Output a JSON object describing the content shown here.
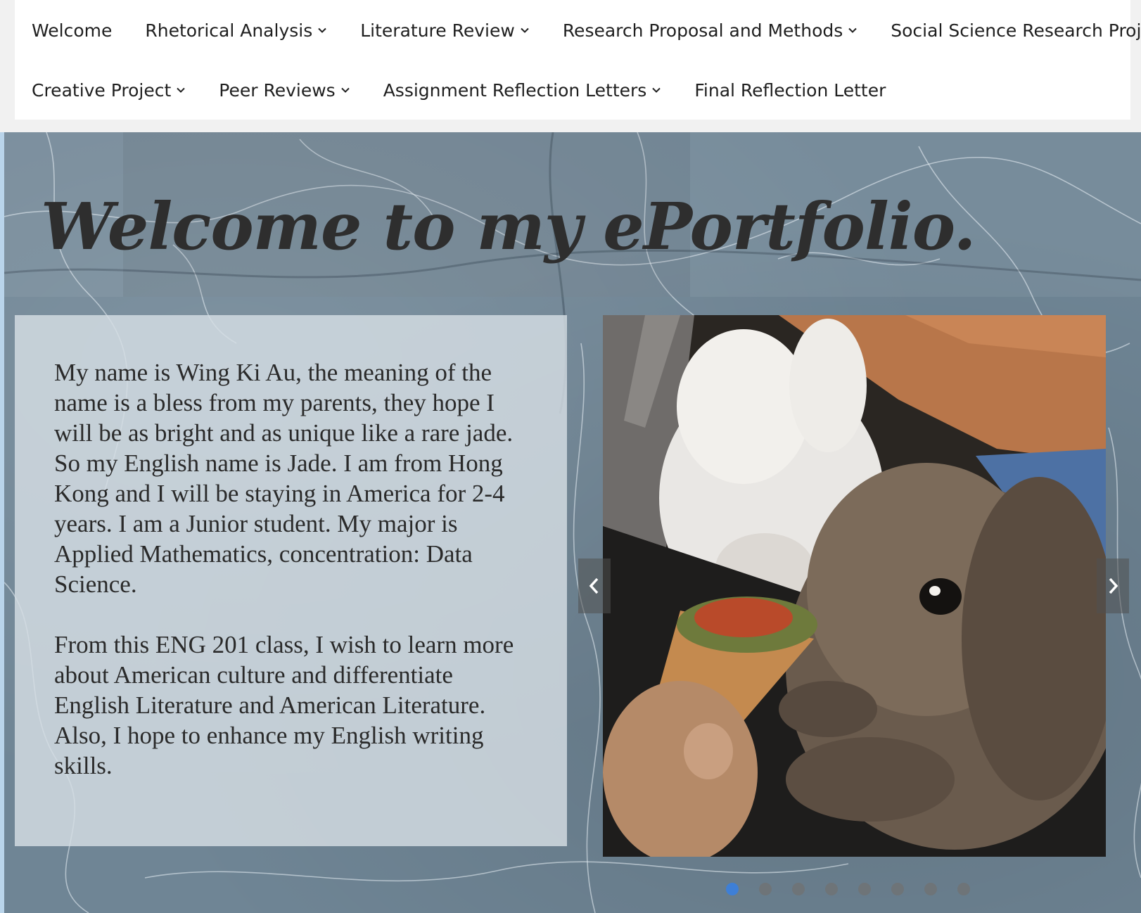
{
  "nav": {
    "row1": [
      {
        "label": "Welcome",
        "has_dropdown": false
      },
      {
        "label": "Rhetorical Analysis",
        "has_dropdown": true
      },
      {
        "label": "Literature Review",
        "has_dropdown": true
      },
      {
        "label": "Research Proposal and Methods",
        "has_dropdown": true
      },
      {
        "label": "Social Science Research Project",
        "has_dropdown": true
      }
    ],
    "row2": [
      {
        "label": "Creative Project",
        "has_dropdown": true
      },
      {
        "label": "Peer Reviews",
        "has_dropdown": true
      },
      {
        "label": "Assignment Reflection Letters",
        "has_dropdown": true
      },
      {
        "label": "Final Reflection Letter",
        "has_dropdown": false
      }
    ]
  },
  "hero": {
    "title": "Welcome to my ePortfolio.",
    "paragraphs": [
      "My name is Wing Ki Au, the meaning of the name is a bless from my parents, they hope I will be as bright and as unique like a rare jade. So my English name is Jade. I am from Hong Kong and I will be staying in America for 2-4 years. I am a Junior student. My major is Applied Mathematics, concentration: Data Science.",
      "From this ENG 201 class, I wish to learn more about American culture and differentiate English Literature and American Literature. Also, I hope to enhance my English writing skills."
    ]
  },
  "slideshow": {
    "slide_count": 8,
    "active_index": 0,
    "active_color": "#3e7fd6",
    "prev_icon": "chevron-left-icon",
    "next_icon": "chevron-right-icon"
  },
  "colors": {
    "marble_base": "#6f8595",
    "panel": "#d6dee4",
    "text": "#2a2a2a",
    "title": "#2e2e2e"
  }
}
